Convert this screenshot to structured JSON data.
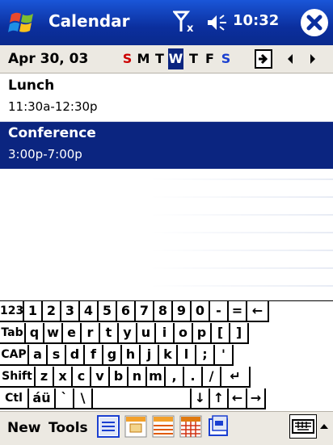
{
  "titlebar": {
    "app_title": "Calendar",
    "clock": "10:32",
    "icons": [
      "windows-flag-icon",
      "signal-off-icon",
      "volume-icon",
      "close-icon"
    ]
  },
  "datebar": {
    "date": "Apr 30, 03",
    "days": [
      "S",
      "M",
      "T",
      "W",
      "T",
      "F",
      "S"
    ],
    "selected_day_index": 3,
    "colors": {
      "sunday": "#cc0000",
      "saturday": "#1a3fd0",
      "selected_bg": "#0b2580"
    }
  },
  "appointments": [
    {
      "title": "Lunch",
      "time": "11:30a-12:30p"
    },
    {
      "title": "Conference",
      "time": "3:00p-7:00p"
    }
  ],
  "keyboard": {
    "rows": [
      [
        "123",
        "1",
        "2",
        "3",
        "4",
        "5",
        "6",
        "7",
        "8",
        "9",
        "0",
        "-",
        "=",
        "←"
      ],
      [
        "Tab",
        "q",
        "w",
        "e",
        "r",
        "t",
        "y",
        "u",
        "i",
        "o",
        "p",
        "[",
        "]"
      ],
      [
        "CAP",
        "a",
        "s",
        "d",
        "f",
        "g",
        "h",
        "j",
        "k",
        "l",
        ";",
        "'"
      ],
      [
        "Shift",
        "z",
        "x",
        "c",
        "v",
        "b",
        "n",
        "m",
        ",",
        ".",
        "/",
        "↵"
      ],
      [
        "Ctl",
        "áü",
        "`",
        "\\",
        "",
        "↓",
        "↑",
        "←",
        "→"
      ]
    ]
  },
  "cmdbar": {
    "menu_new": "New",
    "menu_tools": "Tools",
    "view_buttons": [
      "agenda-view-icon",
      "day-view-icon",
      "week-view-icon",
      "month-view-icon",
      "year-view-icon"
    ]
  },
  "colors": {
    "titlebar": "#0b2f9e",
    "selection": "#0b2580"
  }
}
